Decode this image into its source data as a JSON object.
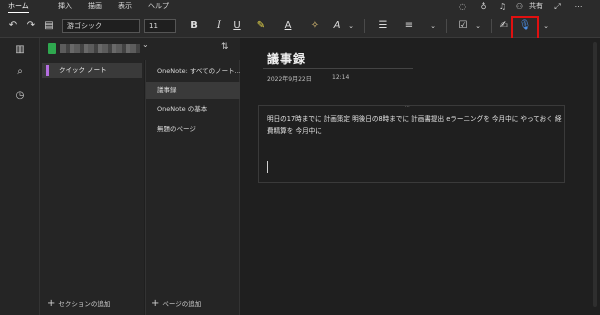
{
  "ribbon": {
    "tabs": [
      "ホーム",
      "挿入",
      "描画",
      "表示",
      "ヘルプ"
    ],
    "share_label": "共有"
  },
  "toolbar": {
    "font_family": "游ゴシック",
    "font_size": "11",
    "bold": "B",
    "italic": "I",
    "underline": "U",
    "font_color": "A",
    "styles": "A"
  },
  "notebook": {
    "name": ""
  },
  "sections": [
    {
      "label": "クイック ノート",
      "color": "#b46ee0"
    }
  ],
  "pages": [
    "OneNote: すべてのノート...",
    "議事録",
    "OneNote の基本",
    "無題のページ"
  ],
  "actions": {
    "add_section": "セクションの追加",
    "add_page": "ページの追加"
  },
  "note": {
    "title": "議事録",
    "date": "2022年9月22日",
    "time": "12:14",
    "body": "明日の17時までに 計画策定 明後日の8時までに 計画書提出 eラーニングを 今月中に やっておく 経費精算を 今月中に"
  },
  "colors": {
    "accent": "#b46ee0",
    "notebook_icon": "#2fa84f",
    "highlight": "#e01010",
    "dictate_icon": "#4a8fe8"
  }
}
